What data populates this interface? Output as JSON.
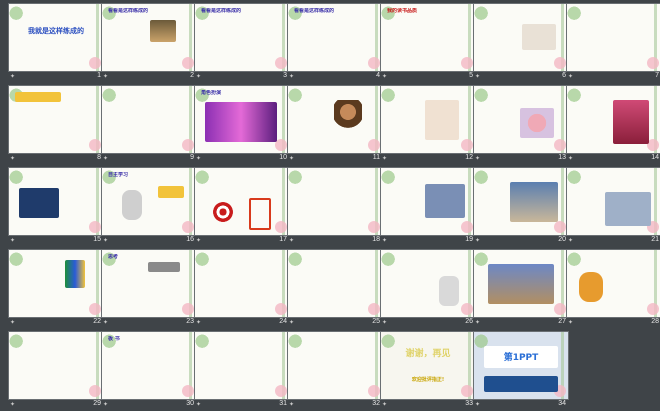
{
  "slides": [
    {
      "num": "1",
      "title": "",
      "body": ""
    },
    {
      "num": "2",
      "title": "看看是这样练成的",
      "body": ""
    },
    {
      "num": "3",
      "title": "看看是这样练成的",
      "body": ""
    },
    {
      "num": "4",
      "title": "看看是这样练成的",
      "body": ""
    },
    {
      "num": "5",
      "title": "我的读书品质",
      "body": ""
    },
    {
      "num": "6",
      "title": "",
      "body": ""
    },
    {
      "num": "7",
      "title": "",
      "body": ""
    },
    {
      "num": "8",
      "title": "",
      "body": ""
    },
    {
      "num": "9",
      "title": "",
      "body": ""
    },
    {
      "num": "10",
      "title": "角色扮演",
      "body": ""
    },
    {
      "num": "11",
      "title": "",
      "body": ""
    },
    {
      "num": "12",
      "title": "",
      "body": ""
    },
    {
      "num": "13",
      "title": "",
      "body": ""
    },
    {
      "num": "14",
      "title": "",
      "body": ""
    },
    {
      "num": "15",
      "title": "",
      "body": ""
    },
    {
      "num": "16",
      "title": "自主学习",
      "body": ""
    },
    {
      "num": "17",
      "title": "",
      "body": ""
    },
    {
      "num": "18",
      "title": "",
      "body": ""
    },
    {
      "num": "19",
      "title": "",
      "body": ""
    },
    {
      "num": "20",
      "title": "",
      "body": ""
    },
    {
      "num": "21",
      "title": "",
      "body": ""
    },
    {
      "num": "22",
      "title": "",
      "body": ""
    },
    {
      "num": "23",
      "title": "思考",
      "body": ""
    },
    {
      "num": "24",
      "title": "",
      "body": ""
    },
    {
      "num": "25",
      "title": "",
      "body": ""
    },
    {
      "num": "26",
      "title": "",
      "body": ""
    },
    {
      "num": "27",
      "title": "",
      "body": ""
    },
    {
      "num": "28",
      "title": "",
      "body": ""
    },
    {
      "num": "29",
      "title": "",
      "body": ""
    },
    {
      "num": "30",
      "title": "板  书",
      "body": ""
    },
    {
      "num": "31",
      "title": "",
      "body": ""
    },
    {
      "num": "32",
      "title": "",
      "body": ""
    },
    {
      "num": "33",
      "title": "谢谢，再见",
      "body": ""
    },
    {
      "num": "34",
      "title": "第1PPT",
      "body": ""
    }
  ],
  "special": {
    "s1_title": "我就是这样练成的",
    "s33_sub": "欢迎批评指正!",
    "s34_brand": "第1PPT"
  }
}
